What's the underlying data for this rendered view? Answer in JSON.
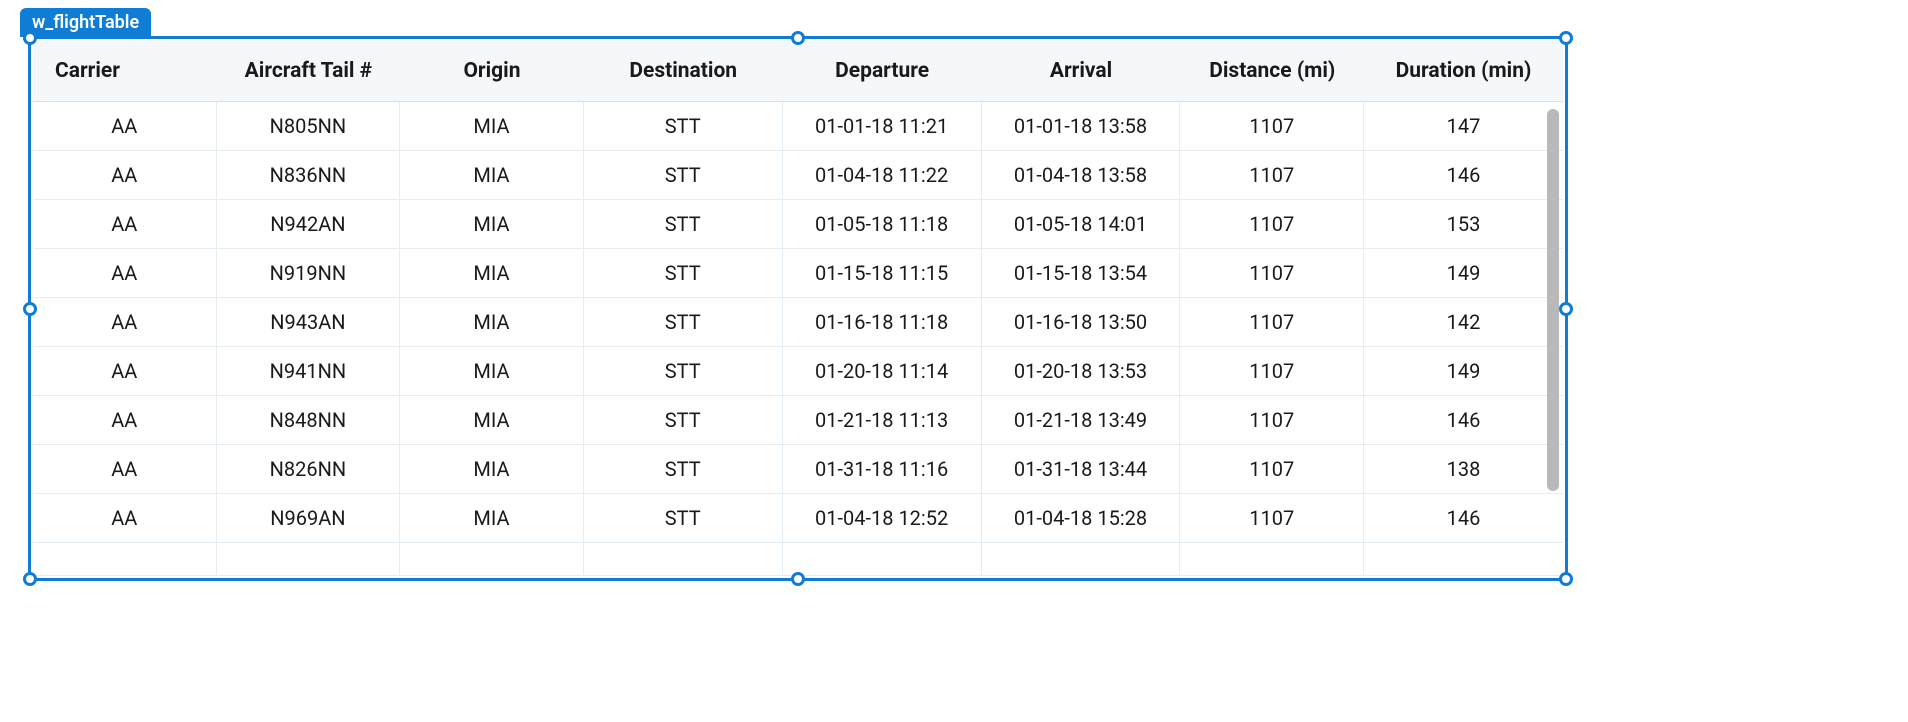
{
  "widget": {
    "name": "w_flightTable"
  },
  "table": {
    "headers": [
      "Carrier",
      "Aircraft Tail #",
      "Origin",
      "Destination",
      "Departure",
      "Arrival",
      "Distance (mi)",
      "Duration (min)"
    ],
    "rows": [
      [
        "AA",
        "N805NN",
        "MIA",
        "STT",
        "01-01-18 11:21",
        "01-01-18 13:58",
        "1107",
        "147"
      ],
      [
        "AA",
        "N836NN",
        "MIA",
        "STT",
        "01-04-18 11:22",
        "01-04-18 13:58",
        "1107",
        "146"
      ],
      [
        "AA",
        "N942AN",
        "MIA",
        "STT",
        "01-05-18 11:18",
        "01-05-18 14:01",
        "1107",
        "153"
      ],
      [
        "AA",
        "N919NN",
        "MIA",
        "STT",
        "01-15-18 11:15",
        "01-15-18 13:54",
        "1107",
        "149"
      ],
      [
        "AA",
        "N943AN",
        "MIA",
        "STT",
        "01-16-18 11:18",
        "01-16-18 13:50",
        "1107",
        "142"
      ],
      [
        "AA",
        "N941NN",
        "MIA",
        "STT",
        "01-20-18 11:14",
        "01-20-18 13:53",
        "1107",
        "149"
      ],
      [
        "AA",
        "N848NN",
        "MIA",
        "STT",
        "01-21-18 11:13",
        "01-21-18 13:49",
        "1107",
        "146"
      ],
      [
        "AA",
        "N826NN",
        "MIA",
        "STT",
        "01-31-18 11:16",
        "01-31-18 13:44",
        "1107",
        "138"
      ],
      [
        "AA",
        "N969AN",
        "MIA",
        "STT",
        "01-04-18 12:52",
        "01-04-18 15:28",
        "1107",
        "146"
      ]
    ]
  }
}
